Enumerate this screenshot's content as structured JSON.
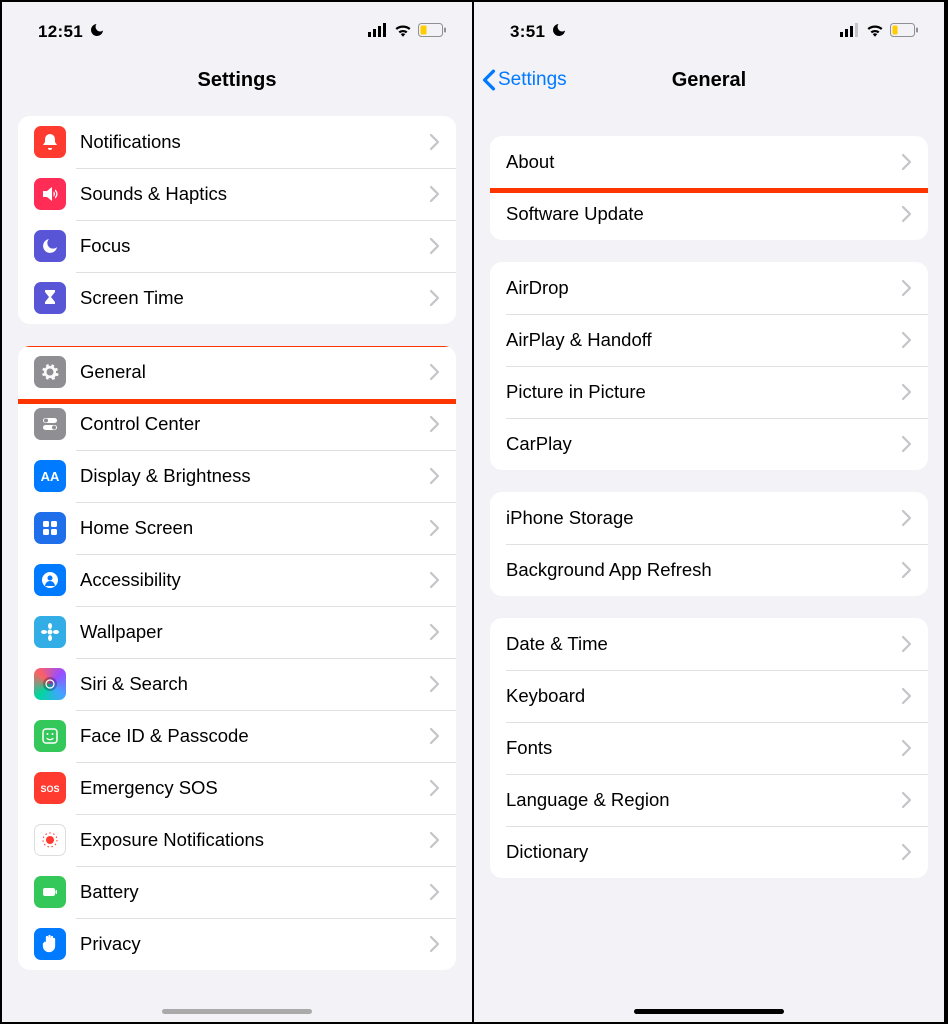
{
  "left": {
    "status": {
      "time": "12:51"
    },
    "title": "Settings",
    "groups": [
      [
        {
          "label": "Notifications",
          "icon": "bell-icon",
          "color": "c-red"
        },
        {
          "label": "Sounds & Haptics",
          "icon": "speaker-icon",
          "color": "c-pink"
        },
        {
          "label": "Focus",
          "icon": "moon-icon",
          "color": "c-indigo"
        },
        {
          "label": "Screen Time",
          "icon": "hourglass-icon",
          "color": "c-indigo"
        }
      ],
      [
        {
          "label": "General",
          "icon": "gear-icon",
          "color": "c-gray",
          "hl": true
        },
        {
          "label": "Control Center",
          "icon": "switches-icon",
          "color": "c-gray"
        },
        {
          "label": "Display & Brightness",
          "icon": "aa-icon",
          "color": "c-blue"
        },
        {
          "label": "Home Screen",
          "icon": "grid-icon",
          "color": "c-deepblue"
        },
        {
          "label": "Accessibility",
          "icon": "person-icon",
          "color": "c-blue"
        },
        {
          "label": "Wallpaper",
          "icon": "flower-icon",
          "color": "c-cyan"
        },
        {
          "label": "Siri & Search",
          "icon": "siri-icon",
          "color": "grad-siri"
        },
        {
          "label": "Face ID & Passcode",
          "icon": "face-icon",
          "color": "c-green"
        },
        {
          "label": "Emergency SOS",
          "icon": "sos-icon",
          "color": "c-sos"
        },
        {
          "label": "Exposure Notifications",
          "icon": "exposure-icon",
          "color": "c-white"
        },
        {
          "label": "Battery",
          "icon": "battery-icon",
          "color": "c-green"
        },
        {
          "label": "Privacy",
          "icon": "hand-icon",
          "color": "c-blue"
        }
      ]
    ]
  },
  "right": {
    "status": {
      "time": "3:51"
    },
    "back": "Settings",
    "title": "General",
    "groups": [
      [
        {
          "label": "About",
          "hl": true
        },
        {
          "label": "Software Update"
        }
      ],
      [
        {
          "label": "AirDrop"
        },
        {
          "label": "AirPlay & Handoff"
        },
        {
          "label": "Picture in Picture"
        },
        {
          "label": "CarPlay"
        }
      ],
      [
        {
          "label": "iPhone Storage"
        },
        {
          "label": "Background App Refresh"
        }
      ],
      [
        {
          "label": "Date & Time"
        },
        {
          "label": "Keyboard"
        },
        {
          "label": "Fonts"
        },
        {
          "label": "Language & Region"
        },
        {
          "label": "Dictionary"
        }
      ]
    ]
  }
}
